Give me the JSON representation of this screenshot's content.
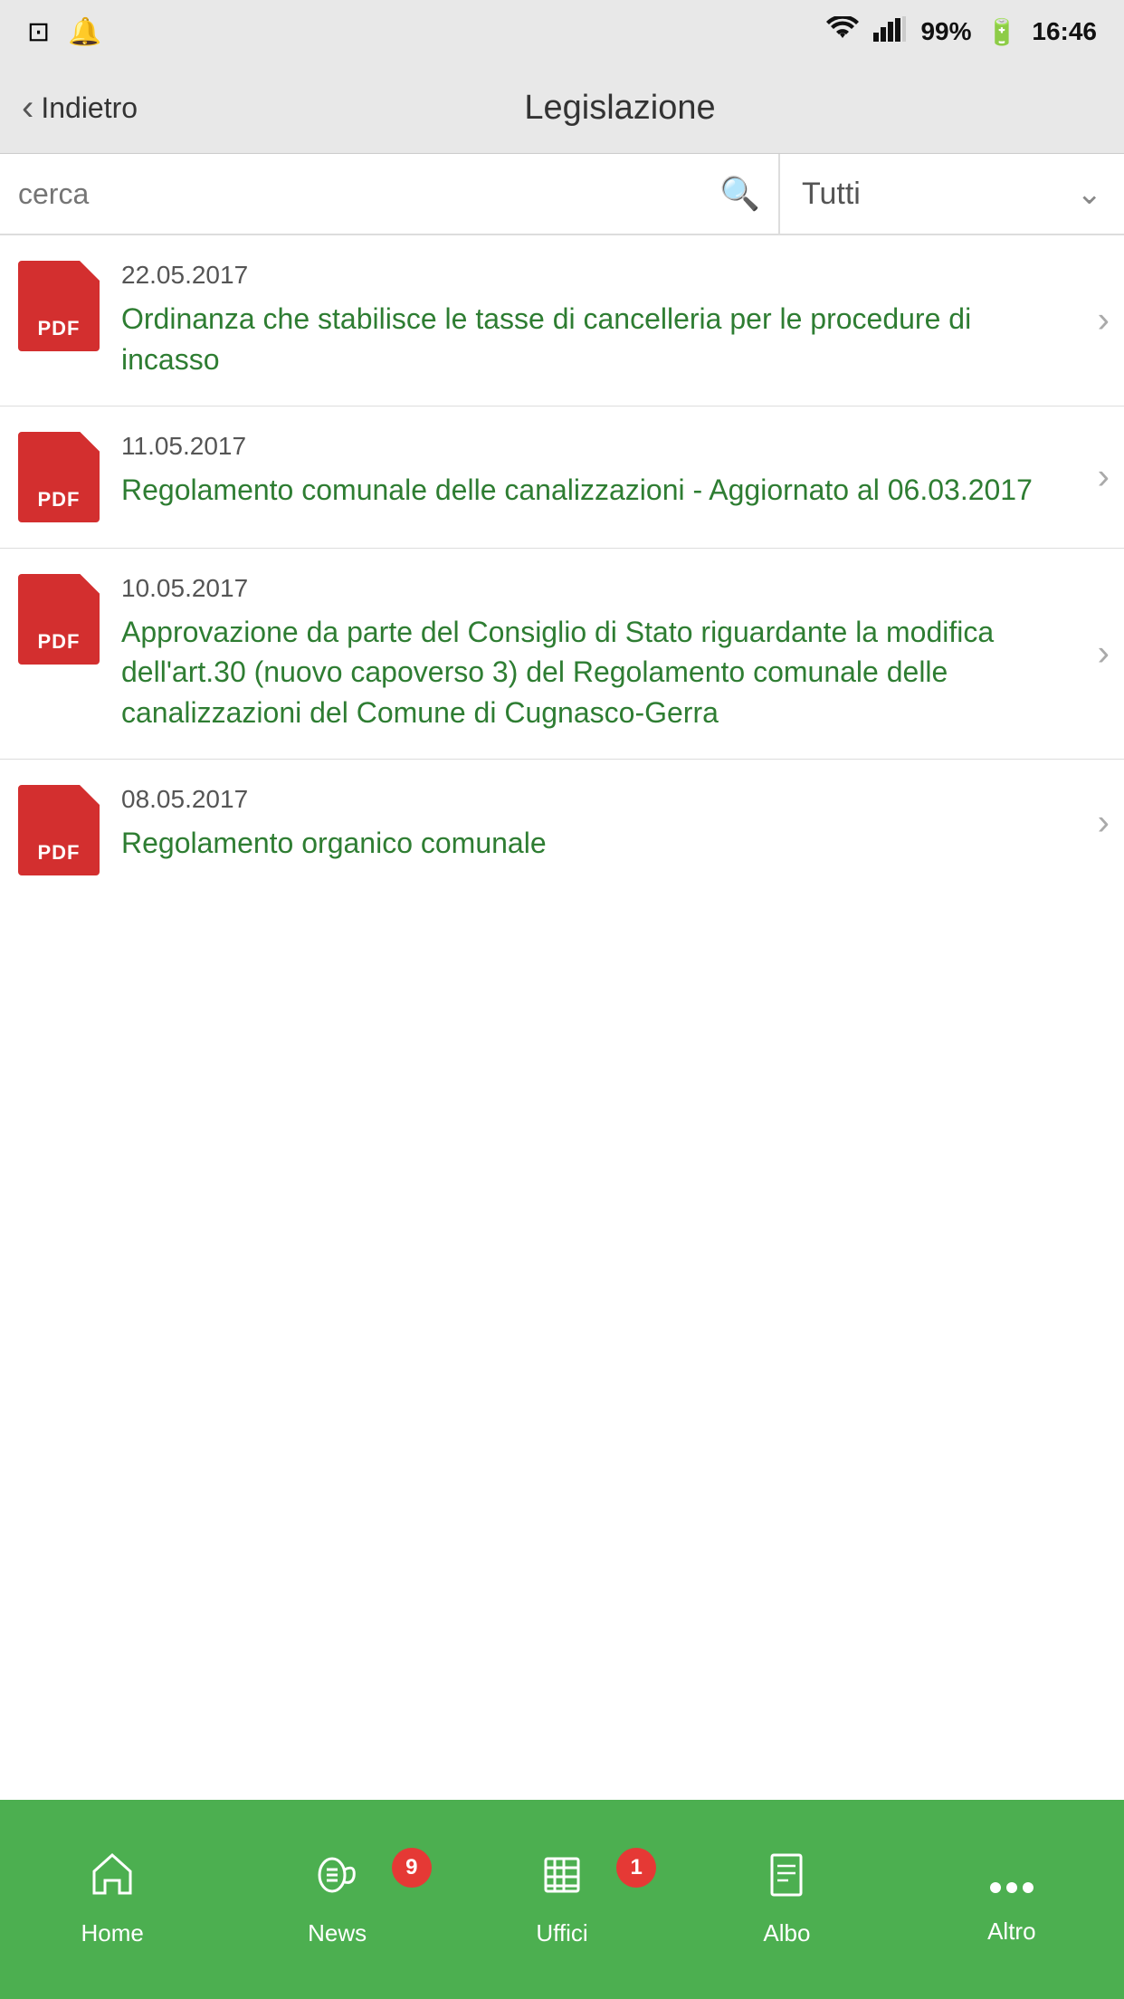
{
  "status_bar": {
    "battery": "99%",
    "time": "16:46",
    "wifi_icon": "wifi",
    "signal_icon": "signal",
    "battery_icon": "battery",
    "notifications_icon": "bell",
    "image_icon": "image"
  },
  "header": {
    "back_label": "Indietro",
    "title": "Legislazione"
  },
  "search": {
    "placeholder": "cerca",
    "filter_label": "Tutti"
  },
  "items": [
    {
      "date": "22.05.2017",
      "title": "Ordinanza che stabilisce le tasse di cancelleria per le procedure di incasso"
    },
    {
      "date": "11.05.2017",
      "title": "Regolamento comunale delle canalizzazioni - Aggiornato al 06.03.2017"
    },
    {
      "date": "10.05.2017",
      "title": "Approvazione da parte del Consiglio di Stato riguardante la modifica dell'art.30 (nuovo capoverso 3) del Regolamento comunale delle canalizzazioni del Comune di Cugnasco-Gerra"
    },
    {
      "date": "08.05.2017",
      "title": "Regolamento organico comunale"
    }
  ],
  "bottom_nav": {
    "home_label": "Home",
    "news_label": "News",
    "uffici_label": "Uffici",
    "albo_label": "Albo",
    "altro_label": "Altro",
    "news_badge": "9",
    "uffici_badge": "1"
  }
}
